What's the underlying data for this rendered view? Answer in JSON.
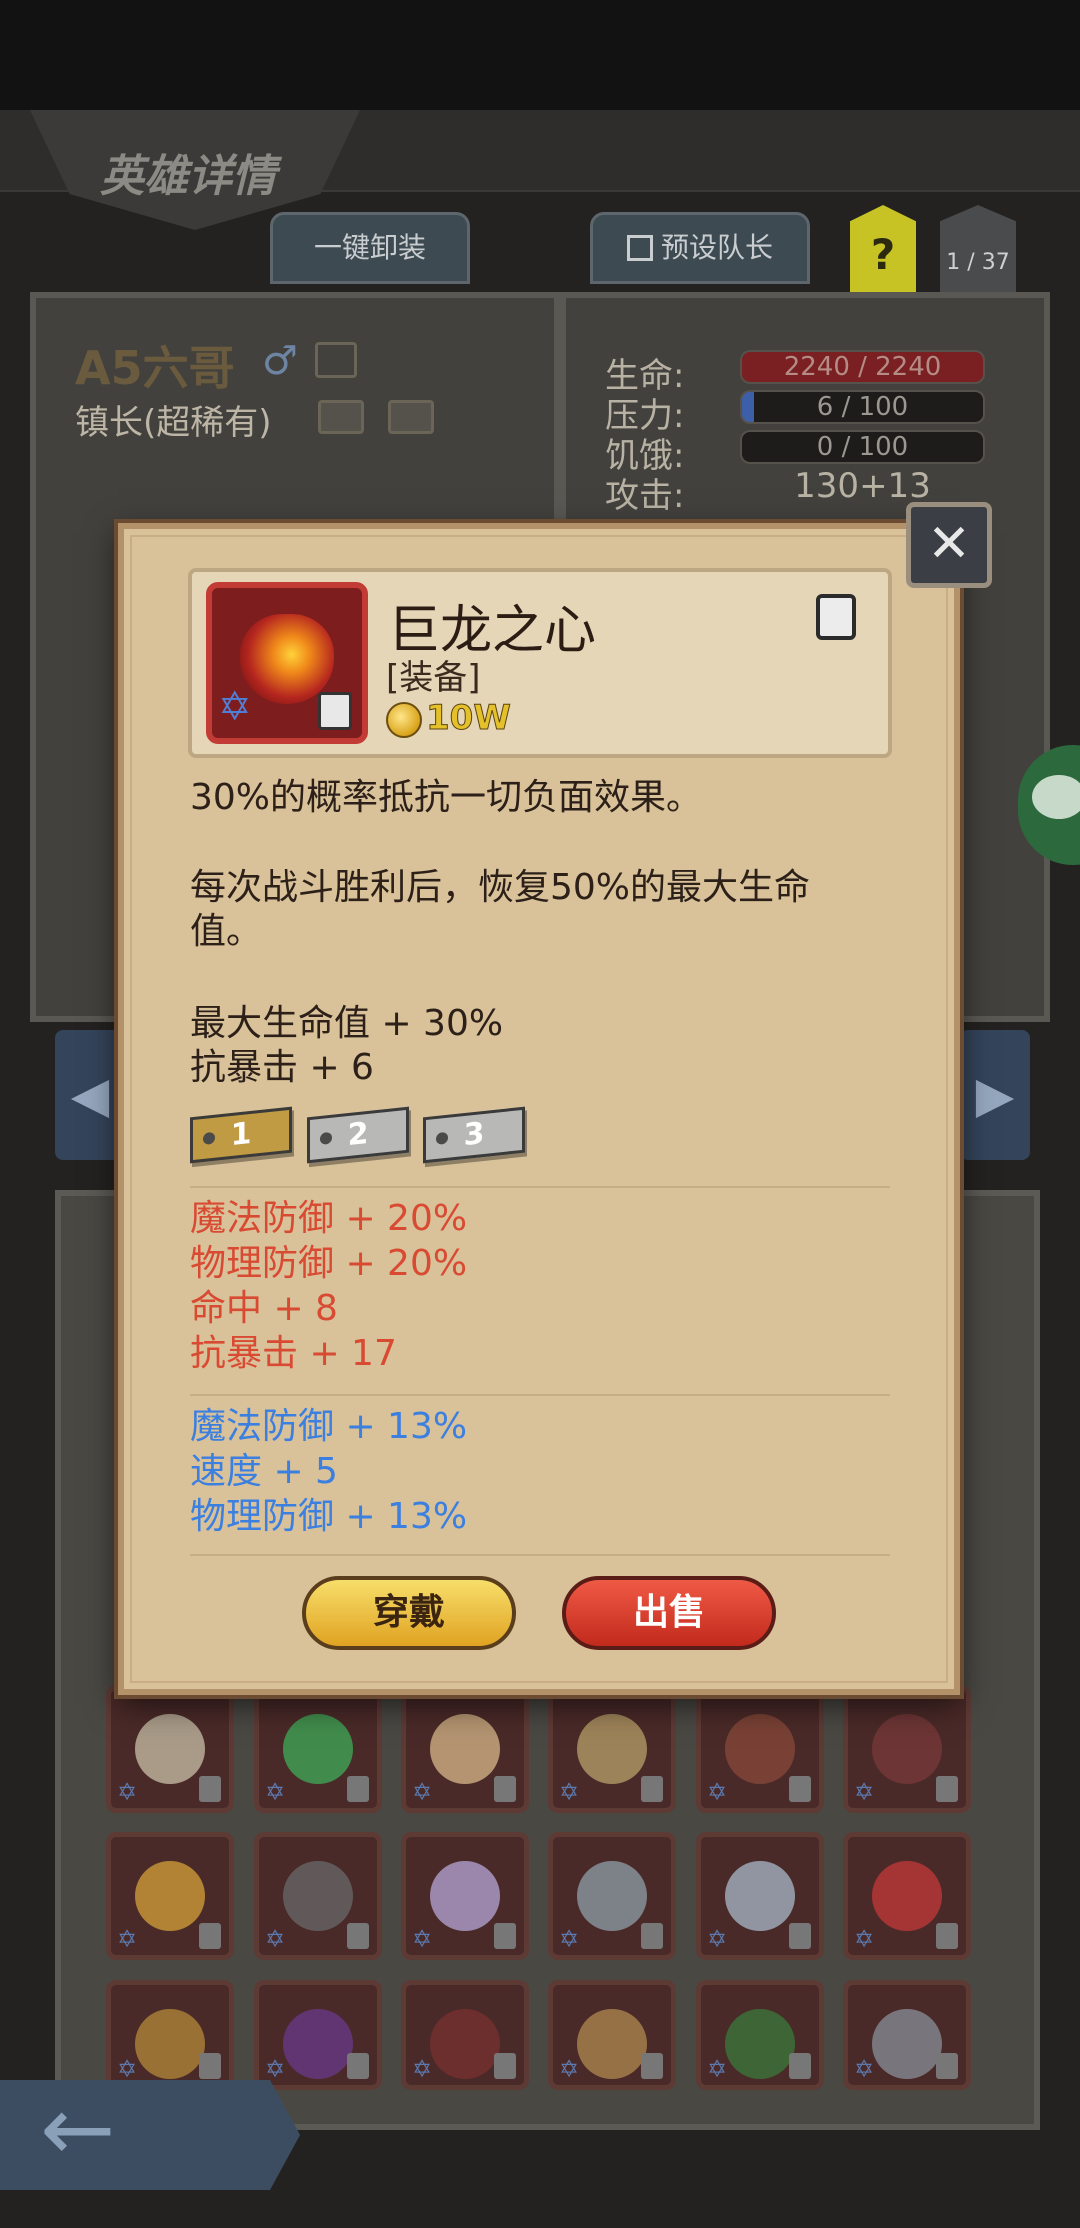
{
  "header": {
    "title": "英雄详情",
    "unequip_all": "一键卸装",
    "preset_leader": "预设队长",
    "help": "?",
    "page_indicator": "1 / 37"
  },
  "hero": {
    "name": "A5六哥",
    "class": "镇长(超稀有)"
  },
  "stats": {
    "hp_label": "生命:",
    "hp_value": "2240 / 2240",
    "pressure_label": "压力:",
    "pressure_value": "6 / 100",
    "pressure_fraction": 0.06,
    "hunger_label": "饥饿:",
    "hunger_value": "0 / 100",
    "attack_label": "攻击:",
    "attack_value": "130+13"
  },
  "item_popup": {
    "name": "巨龙之心",
    "type": "[装备]",
    "price": "10W",
    "desc1": "30%的概率抵抗一切负面效果。",
    "desc2_line1": "每次战斗胜利后，恢复50%的最大生命",
    "desc2_line2": "值。",
    "base_stats": [
      "最大生命值 + 30%",
      "抗暴击 + 6"
    ],
    "tiers": [
      "1",
      "2",
      "3"
    ],
    "red_stats": [
      "魔法防御 + 20%",
      "物理防御 + 20%",
      "命中 + 8",
      "抗暴击 + 17"
    ],
    "blue_stats": [
      "魔法防御 + 13%",
      "速度 + 5",
      "物理防御 + 13%"
    ],
    "wear_label": "穿戴",
    "sell_label": "出售"
  },
  "colors": {
    "red_stat": "#d94a33",
    "blue_stat": "#3b7fe0",
    "price": "#e4c12a"
  },
  "inventory_icons": [
    [
      "winged-helm-icon",
      "green-feather-icon",
      "horn-icon",
      "golden-helmet-icon",
      "dark-helmet-icon",
      "axe-icon"
    ],
    [
      "ring-icon",
      "spiked-armor-icon",
      "crystal-cluster-icon",
      "crown-icon",
      "staff-icon",
      "amulet-icon"
    ],
    [
      "gauntlet-icon",
      "wizard-hat-icon",
      "belt-icon",
      "eye-ring-icon",
      "green-armor-icon",
      "dagger-icon"
    ]
  ]
}
